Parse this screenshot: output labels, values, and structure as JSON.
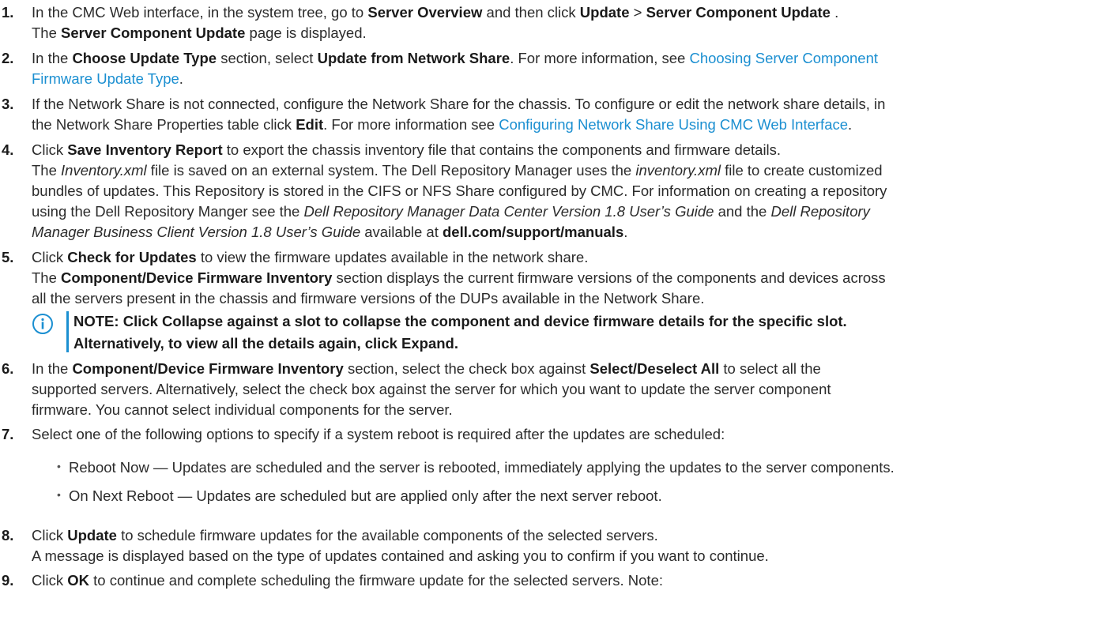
{
  "steps": [
    {
      "num": "1.",
      "lines": [
        [
          "In the CMC Web interface, in the system tree, go to ",
          "**Server Overview",
          " and then click ",
          "**Update",
          " > ",
          "**Server Component Update",
          " ."
        ],
        [
          "The ",
          "**Server Component Update",
          " page is displayed."
        ]
      ]
    },
    {
      "num": "2.",
      "lines": [
        [
          "In the ",
          "**Choose Update Type",
          " section, select ",
          "**Update from Network Share",
          ". For more information, see ",
          "@@Choosing Server Component"
        ],
        [
          "@@Firmware Update Type",
          "."
        ]
      ]
    },
    {
      "num": "3.",
      "lines": [
        [
          "If the Network Share is not connected, configure the Network Share for the chassis. To configure or edit the network share details, in"
        ],
        [
          "the Network Share Properties table click ",
          "**Edit",
          ". For more information see ",
          "@@Configuring Network Share Using CMC Web Interface",
          "."
        ]
      ]
    },
    {
      "num": "4.",
      "lines": [
        [
          "Click ",
          "**Save Inventory Report",
          " to export the chassis inventory file that contains the components and firmware details."
        ],
        [
          "The ",
          "//Inventory.xml",
          " file is saved on an external system. The Dell Repository Manager uses the ",
          "//inventory.xml",
          " file to create customized"
        ],
        [
          "bundles of updates. This Repository is stored in the CIFS or NFS Share configured by CMC. For information on creating a repository"
        ],
        [
          "using the Dell Repository Manger see the ",
          "//Dell Repository Manager Data Center Version 1.8 User’s Guide",
          " and the ",
          "//Dell Repository"
        ],
        [
          "//Manager Business Client Version 1.8 User’s Guide",
          " available at ",
          "**dell.com/support/manuals",
          "."
        ]
      ]
    },
    {
      "num": "5.",
      "lines": [
        [
          "Click ",
          "**Check for Updates",
          " to view the firmware updates available in the network share."
        ],
        [
          "The ",
          "**Component/Device Firmware Inventory",
          " section displays the current firmware versions of the components and devices across"
        ],
        [
          "all the servers present in the chassis and firmware versions of the DUPs available in the Network Share."
        ]
      ]
    },
    {
      "num": "6.",
      "lines": [
        [
          "In the ",
          "**Component/Device Firmware Inventory",
          " section, select the check box against ",
          "**Select/Deselect All",
          " to select all the"
        ],
        [
          "supported servers. Alternatively, select the check box against the server for which you want to update the server component"
        ],
        [
          "firmware. You cannot select individual components for the server."
        ]
      ]
    },
    {
      "num": "7.",
      "lines": [
        [
          "Select one of the following options to specify if a system reboot is required after the updates are scheduled:"
        ]
      ]
    },
    {
      "num": "8.",
      "lines": [
        [
          "Click ",
          "**Update",
          " to schedule firmware updates for the available components of the selected servers."
        ],
        [
          "A message is displayed based on the type of updates contained and asking you to confirm if you want to continue."
        ]
      ]
    },
    {
      "num": "9.",
      "lines": [
        [
          "Click ",
          "**OK",
          " to continue and complete scheduling the firmware update for the selected servers. Note:"
        ]
      ]
    }
  ],
  "note": {
    "icon": "info-icon",
    "label": "NOTE:",
    "line1": " Click Collapse against a slot to collapse the component and device firmware details for the specific slot.",
    "line2": "Alternatively, to view all the details again, click Expand."
  },
  "bullets": [
    "Reboot Now — Updates are scheduled and the server is rebooted, immediately applying the updates to the server components.",
    "On Next Reboot — Updates are scheduled but are applied only after the next server reboot."
  ],
  "colors": {
    "link": "#1b8fd1",
    "text": "#2b2b2b",
    "note_bar": "#1b8fd1"
  }
}
